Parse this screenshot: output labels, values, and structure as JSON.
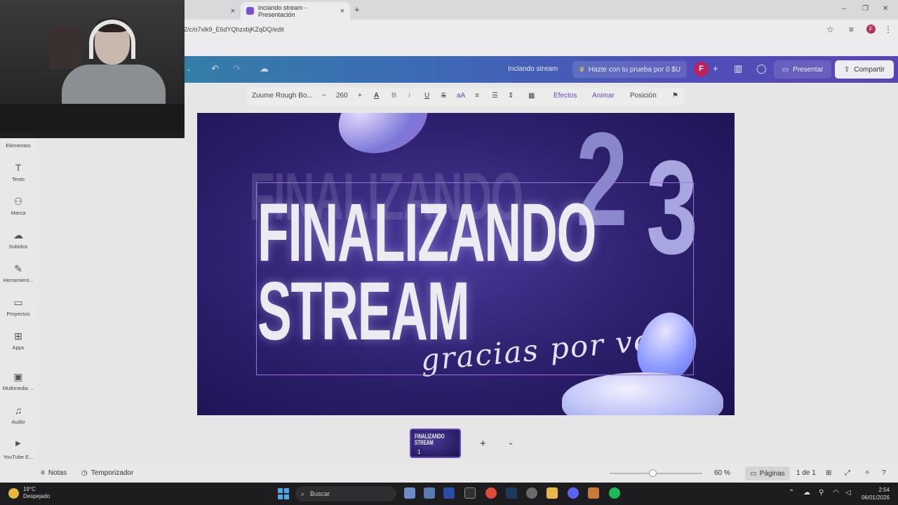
{
  "browser": {
    "tabs": [
      {
        "label": "",
        "close": "×"
      },
      {
        "label": "inciando stream - Presentación",
        "close": "×"
      }
    ],
    "new_tab": "+",
    "url": "2/c/o7xlk9_E6dYQhzxbjKZqDQ/edit",
    "window_controls": [
      "–",
      "❐",
      "✕"
    ],
    "profile_initial": "F"
  },
  "header": {
    "doc_title": "Inclando stream",
    "trial_label": "Hazte con tu prueba por 0 $U",
    "avatar_initial": "F",
    "present_label": "Presentar",
    "share_label": "Compartir"
  },
  "sidebar": {
    "items": [
      {
        "label": "Elementos",
        "icon": "elements-icon"
      },
      {
        "label": "Texto",
        "icon": "text-icon"
      },
      {
        "label": "Marca",
        "icon": "brand-icon"
      },
      {
        "label": "Subidos",
        "icon": "upload-icon"
      },
      {
        "label": "Herramient...",
        "icon": "draw-icon"
      },
      {
        "label": "Proyectos",
        "icon": "folder-icon"
      },
      {
        "label": "Apps",
        "icon": "apps-icon"
      },
      {
        "label": "Multimedia ...",
        "icon": "media-icon"
      },
      {
        "label": "Audio",
        "icon": "audio-icon"
      },
      {
        "label": "YouTube E...",
        "icon": "youtube-icon"
      }
    ]
  },
  "text_toolbar": {
    "font": "Zuume Rough Bo...",
    "size": "260",
    "effects": "Efectos",
    "animate": "Animar",
    "position": "Posición"
  },
  "design": {
    "ghost_line": "FINALIZANDO",
    "title_line1": "FINALIZANDO",
    "title_line2": "STREAM",
    "num1": "2",
    "num2": "3",
    "script": "gracias por ver!"
  },
  "pages": {
    "thumb_line1": "FINALIZANDO",
    "thumb_line2": "STREAM",
    "thumb_number": "1"
  },
  "bottombar": {
    "notes": "Notas",
    "timer": "Temporizador",
    "zoom": "60 %",
    "zoom_level": 0.6,
    "pages": "Páginas",
    "page_count": "1 de 1"
  },
  "taskbar": {
    "temperature": "19°C",
    "weather": "Despejado",
    "search": "Buscar",
    "time": "2:54",
    "date": "06/01/2026"
  },
  "colors": {
    "accent": "#6a45b8",
    "canvas_bg": "#2c1f6c",
    "avatar": "#c0205a"
  }
}
